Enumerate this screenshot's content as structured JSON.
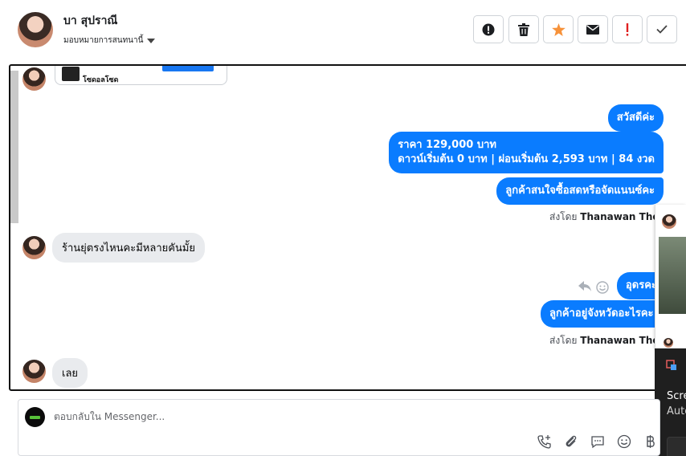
{
  "header": {
    "contact_name": "บา สุปราณี",
    "assign_label": "มอบหมายการสนทนานี้",
    "tools": [
      {
        "name": "mark-spam",
        "icon": "alert-circle-icon"
      },
      {
        "name": "delete",
        "icon": "trash-icon"
      },
      {
        "name": "star",
        "icon": "star-icon",
        "color": "#f7923a"
      },
      {
        "name": "mark-unread",
        "icon": "envelope-icon"
      },
      {
        "name": "follow-up",
        "icon": "exclamation-icon",
        "color": "#e02020"
      },
      {
        "name": "done",
        "icon": "checkmark-icon"
      }
    ]
  },
  "chat": {
    "shared_post_title": "โซดอลโซด",
    "messages": {
      "out_greeting": "สวัสดีค่ะ",
      "out_price_line1": "ราคา 129,000 บาท",
      "out_price_line2": "ดาวน์เริ่มต้น 0 บาท | ผ่อนเริ่มต้น 2,593 บาท | 84 งวด",
      "out_question": "ลูกค้าสนใจซื้อสดหรือจัดแนนซ์คะ",
      "sent_by_1_prefix": "ส่งโดย",
      "sent_by_1_name": "Thanawan Thon",
      "in_store_location": "ร้านยุ่ตรงไหนคะมีหลายคันมั้ย",
      "out_udon": "อุดรคะ",
      "out_province": "ลูกค้าอยู่จังหวัดอะไรคะ",
      "sent_by_2_prefix": "ส่งโดย",
      "sent_by_2_name": "Thanawan Thon",
      "in_loei": "เลย"
    }
  },
  "popup": {
    "line1": "Scre",
    "line2": "Auto"
  },
  "reply": {
    "placeholder": "ตอบกลับใน Messenger...",
    "tools": [
      "call-plus-icon",
      "paperclip-icon",
      "chat-bubble-icon",
      "smile-icon",
      "baht-icon"
    ]
  },
  "colors": {
    "outgoing_bubble": "#0a7cff",
    "incoming_bubble": "#e9ebee"
  }
}
